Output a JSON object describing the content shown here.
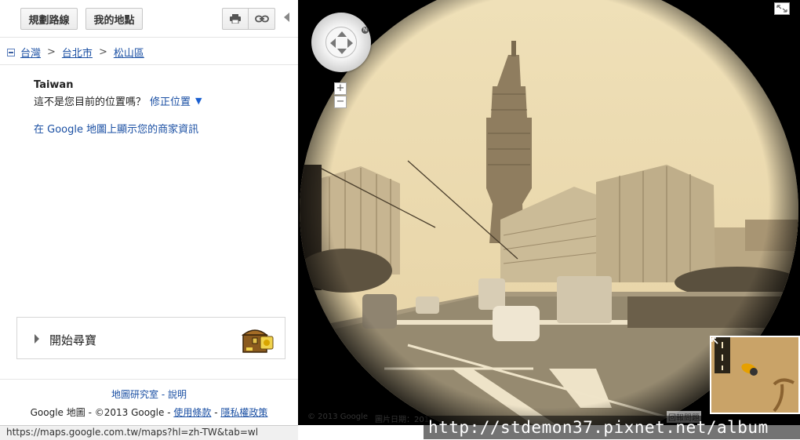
{
  "toolbar": {
    "route_label": "規劃路線",
    "my_places_label": "我的地點",
    "print_icon": "printer-icon",
    "link_icon": "link-icon"
  },
  "breadcrumb": [
    "台灣",
    "台北市",
    "松山區"
  ],
  "place": {
    "title": "Taiwan",
    "not_here_text": "這不是您目前的位置嗎？",
    "fix_link": "修正位置",
    "business_link": "在 Google 地圖上顯示您的商家資訊"
  },
  "treasure": {
    "label": "開始尋寶",
    "icon": "treasure-chest-icon"
  },
  "footer": {
    "lab_link": "地圖研究室",
    "dash": " - ",
    "help_link": "說明",
    "copyright": "Google 地圖 - ©2013 Google - ",
    "terms_link": "使用條款",
    "privacy_link": "隱私權政策"
  },
  "status_url": "https://maps.google.com.tw/maps?hl=zh-TW&tab=wl",
  "streetview": {
    "copyright": "© 2013 Google",
    "date": "圖片日期：201",
    "zoom_in": "+",
    "zoom_out": "−",
    "compass_n": "N",
    "report": "回報問題"
  },
  "watermark": "http://stdemon37.pixnet.net/album",
  "colors": {
    "link": "#1a4fa3",
    "sepia": "#e8d5a8"
  }
}
